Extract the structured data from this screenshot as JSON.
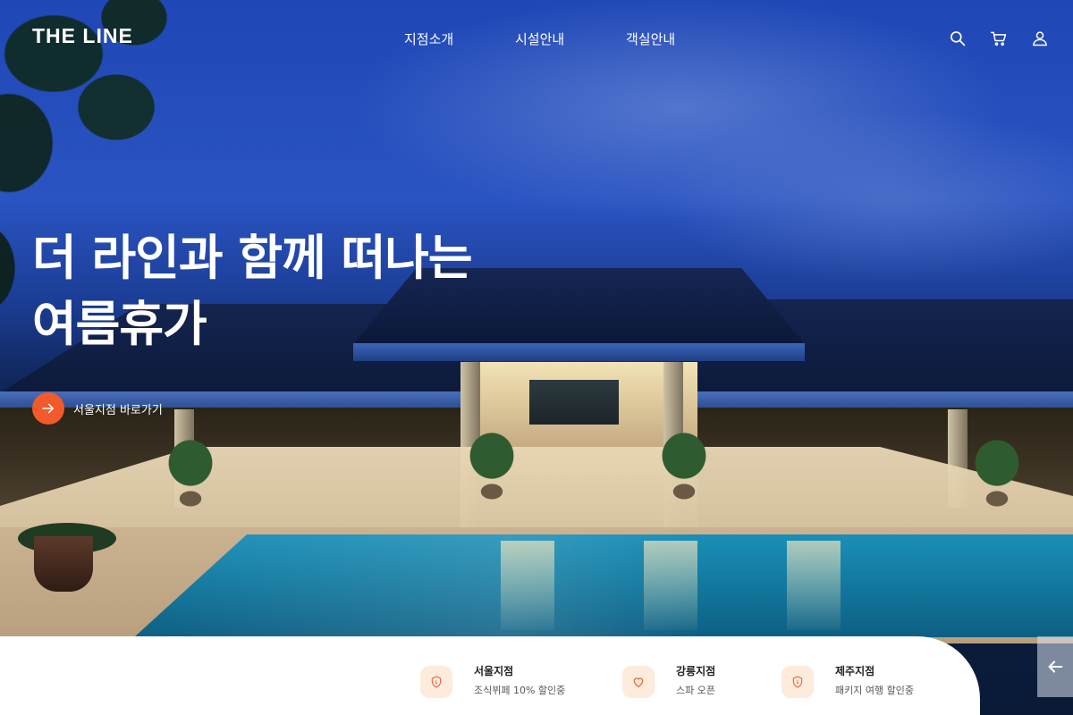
{
  "header": {
    "logo": "THE LINE",
    "nav": [
      {
        "label": "지점소개"
      },
      {
        "label": "시설안내"
      },
      {
        "label": "객실안내"
      }
    ],
    "icons": [
      "search-icon",
      "cart-icon",
      "user-icon"
    ]
  },
  "hero": {
    "headline_line1": "더 라인과 함께 떠나는",
    "headline_line2": "여름휴가",
    "cta_label": "서울지점 바로가기",
    "cta_icon": "arrow-right-icon",
    "accent_color": "#f25a2b"
  },
  "branches": [
    {
      "name": "서울지점",
      "desc": "조식뷔페 10% 할인중",
      "icon": "coupon-shield-icon"
    },
    {
      "name": "강릉지점",
      "desc": "스파 오픈",
      "icon": "heart-icon"
    },
    {
      "name": "제주지점",
      "desc": "패키지 여행 할인중",
      "icon": "coupon-shield-icon"
    }
  ],
  "side_nav": {
    "icon": "arrow-left-icon"
  },
  "colors": {
    "branch_icon_bg": "#fdebdc",
    "branch_icon_stroke": "#e8603a"
  }
}
